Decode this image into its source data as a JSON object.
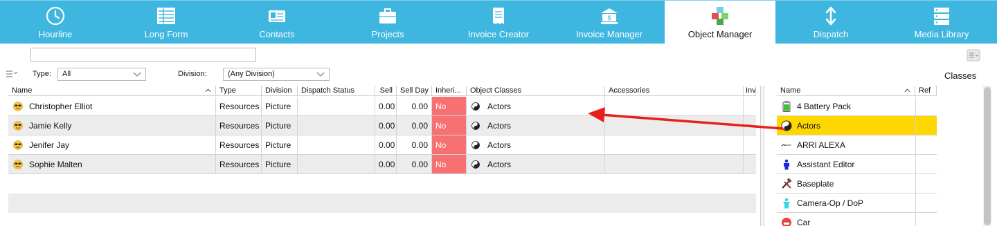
{
  "nav": {
    "tabs": [
      {
        "label": "Hourline",
        "icon": "clock-icon"
      },
      {
        "label": "Long Form",
        "icon": "long-form-icon"
      },
      {
        "label": "Contacts",
        "icon": "contacts-card-icon"
      },
      {
        "label": "Projects",
        "icon": "briefcase-icon"
      },
      {
        "label": "Invoice Creator",
        "icon": "receipt-icon"
      },
      {
        "label": "Invoice Manager",
        "icon": "bank-icon"
      },
      {
        "label": "Object Manager",
        "icon": "cubes-icon"
      },
      {
        "label": "Dispatch",
        "icon": "up-down-arrow-icon"
      },
      {
        "label": "Media Library",
        "icon": "server-rack-icon"
      }
    ],
    "active": "Object Manager"
  },
  "search": {
    "value": "",
    "placeholder": ""
  },
  "filters": {
    "type_label": "Type:",
    "type_value": "All",
    "division_label": "Division:",
    "division_value": "(Any Division)"
  },
  "main_table": {
    "columns": [
      "Name",
      "Type",
      "Division",
      "Dispatch Status",
      "Sell",
      "Sell Day",
      "Inheri...",
      "Object Classes",
      "Accessories",
      "Inv"
    ],
    "rows": [
      {
        "name": "Christopher Elliot",
        "type": "Resources",
        "division": "Picture",
        "dispatch": "",
        "sell": "0.00",
        "sell_day": "0.00",
        "inherit": "No",
        "object_class": "Actors",
        "accessories": ""
      },
      {
        "name": "Jamie Kelly",
        "type": "Resources",
        "division": "Picture",
        "dispatch": "",
        "sell": "0.00",
        "sell_day": "0.00",
        "inherit": "No",
        "object_class": "Actors",
        "accessories": ""
      },
      {
        "name": "Jenifer Jay",
        "type": "Resources",
        "division": "Picture",
        "dispatch": "",
        "sell": "0.00",
        "sell_day": "0.00",
        "inherit": "No",
        "object_class": "Actors",
        "accessories": ""
      },
      {
        "name": "Sophie Malten",
        "type": "Resources",
        "division": "Picture",
        "dispatch": "",
        "sell": "0.00",
        "sell_day": "0.00",
        "inherit": "No",
        "object_class": "Actors",
        "accessories": ""
      }
    ]
  },
  "classes_panel": {
    "title": "Classes",
    "columns": [
      "Name",
      "Ref"
    ],
    "selected": "Actors",
    "items": [
      {
        "name": "4 Battery Pack",
        "icon": "battery-icon"
      },
      {
        "name": "Actors",
        "icon": "yin-yang-icon"
      },
      {
        "name": "ARRI ALEXA",
        "icon": "arri-logo-icon"
      },
      {
        "name": "Assistant Editor",
        "icon": "person-icon"
      },
      {
        "name": "Baseplate",
        "icon": "tools-icon"
      },
      {
        "name": "Camera-Op / DoP",
        "icon": "person-icon"
      },
      {
        "name": "Car",
        "icon": "car-icon"
      }
    ]
  },
  "colors": {
    "nav_bg": "#3fb6df",
    "inherit_no": "#f87172",
    "selection": "#ffd700",
    "annotation_arrow": "#e8201c"
  }
}
